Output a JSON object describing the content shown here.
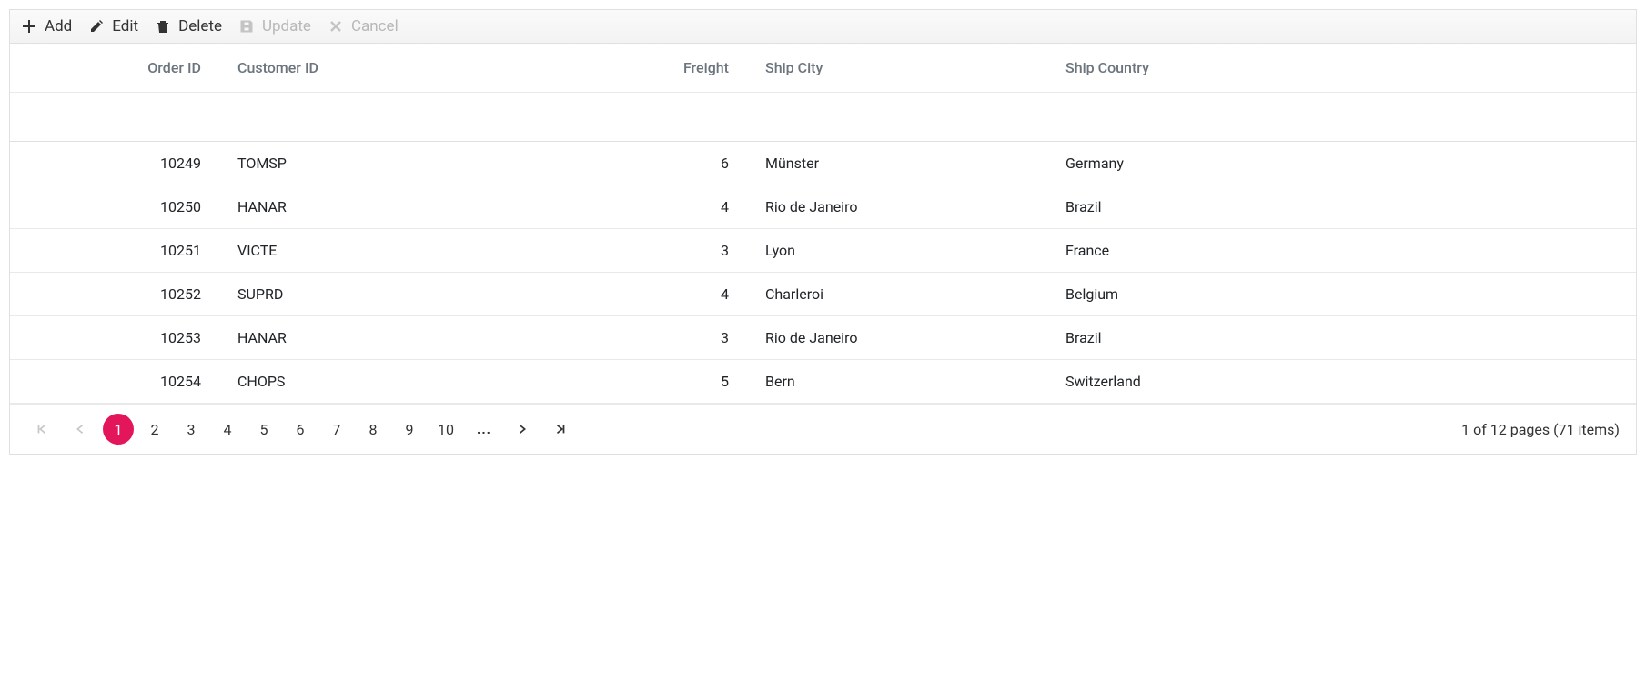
{
  "toolbar": {
    "add_label": "Add",
    "edit_label": "Edit",
    "delete_label": "Delete",
    "update_label": "Update",
    "cancel_label": "Cancel"
  },
  "columns": {
    "order_id": "Order ID",
    "customer_id": "Customer ID",
    "freight": "Freight",
    "ship_city": "Ship City",
    "ship_country": "Ship Country"
  },
  "rows": [
    {
      "order_id": "10249",
      "customer_id": "TOMSP",
      "freight": "6",
      "ship_city": "Münster",
      "ship_country": "Germany"
    },
    {
      "order_id": "10250",
      "customer_id": "HANAR",
      "freight": "4",
      "ship_city": "Rio de Janeiro",
      "ship_country": "Brazil"
    },
    {
      "order_id": "10251",
      "customer_id": "VICTE",
      "freight": "3",
      "ship_city": "Lyon",
      "ship_country": "France"
    },
    {
      "order_id": "10252",
      "customer_id": "SUPRD",
      "freight": "4",
      "ship_city": "Charleroi",
      "ship_country": "Belgium"
    },
    {
      "order_id": "10253",
      "customer_id": "HANAR",
      "freight": "3",
      "ship_city": "Rio de Janeiro",
      "ship_country": "Brazil"
    },
    {
      "order_id": "10254",
      "customer_id": "CHOPS",
      "freight": "5",
      "ship_city": "Bern",
      "ship_country": "Switzerland"
    }
  ],
  "pager": {
    "pages": [
      "1",
      "2",
      "3",
      "4",
      "5",
      "6",
      "7",
      "8",
      "9",
      "10"
    ],
    "ellipsis": "...",
    "active": "1",
    "info": "1 of 12 pages (71 items)"
  }
}
